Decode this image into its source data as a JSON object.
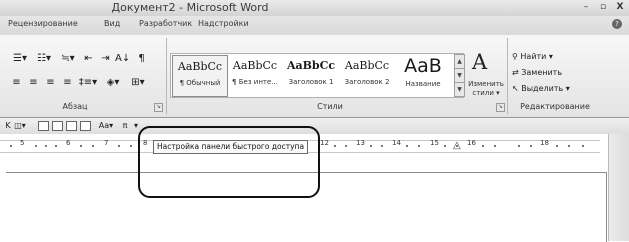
{
  "window": {
    "title": "Документ2 - Microsoft Word",
    "minimize": "–",
    "maximize": "▫",
    "close": "X"
  },
  "tabs": [
    {
      "label": "Рецензирование"
    },
    {
      "label": "Вид"
    },
    {
      "label": "Разработчик"
    },
    {
      "label": "Надстройки"
    }
  ],
  "help": "?",
  "groups": {
    "paragraph": "Абзац",
    "styles": "Стили",
    "editing": "Редактирование",
    "launcher_icon": "dialog-launcher-icon"
  },
  "paragraph_buttons": {
    "row1": [
      "☰▾",
      "☷▾",
      "≒▾",
      "⇤",
      "⇥",
      "A↓",
      "¶"
    ],
    "row2": [
      "≡",
      "≡",
      "≡",
      "≡",
      "‡≡▾",
      "◈▾",
      "⊞▾"
    ]
  },
  "styles_gallery": [
    {
      "sample": "AaBbCc",
      "caption": "¶ Обычный",
      "selected": true,
      "kind": "normal"
    },
    {
      "sample": "AaBbCc",
      "caption": "¶ Без инте...",
      "selected": false,
      "kind": "normal"
    },
    {
      "sample": "AaBbCс",
      "caption": "Заголовок 1",
      "selected": false,
      "kind": "heading"
    },
    {
      "sample": "AaBbCc",
      "caption": "Заголовок 2",
      "selected": false,
      "kind": "normal"
    },
    {
      "sample": "АаВ",
      "caption": "Название",
      "selected": false,
      "kind": "big"
    }
  ],
  "gallery_scroll": {
    "up": "▲",
    "down": "▼"
  },
  "change_styles": {
    "icon": "A",
    "label_line1": "Изменить",
    "label_line2": "стили ▾"
  },
  "editing": {
    "find": "Найти ▾",
    "replace": "Заменить",
    "select": "Выделить ▾",
    "find_icon": "binoculars-icon",
    "replace_icon": "replace-icon",
    "select_icon": "cursor-icon"
  },
  "quick_access": {
    "buttons": [
      "K",
      "◫▾",
      "□",
      "☒",
      "▤",
      "▣",
      "Aa▾",
      "π",
      "▾"
    ],
    "customize_icon": "▾"
  },
  "ruler": {
    "numbers_left": [
      "5",
      "6",
      "7",
      "8"
    ],
    "numbers_right": [
      "12",
      "13",
      "14",
      "15",
      "16",
      "18"
    ],
    "indent_marker": "△",
    "toggle_icon": "▿"
  },
  "tooltip": {
    "text": "Настройка панели быстрого доступа"
  }
}
